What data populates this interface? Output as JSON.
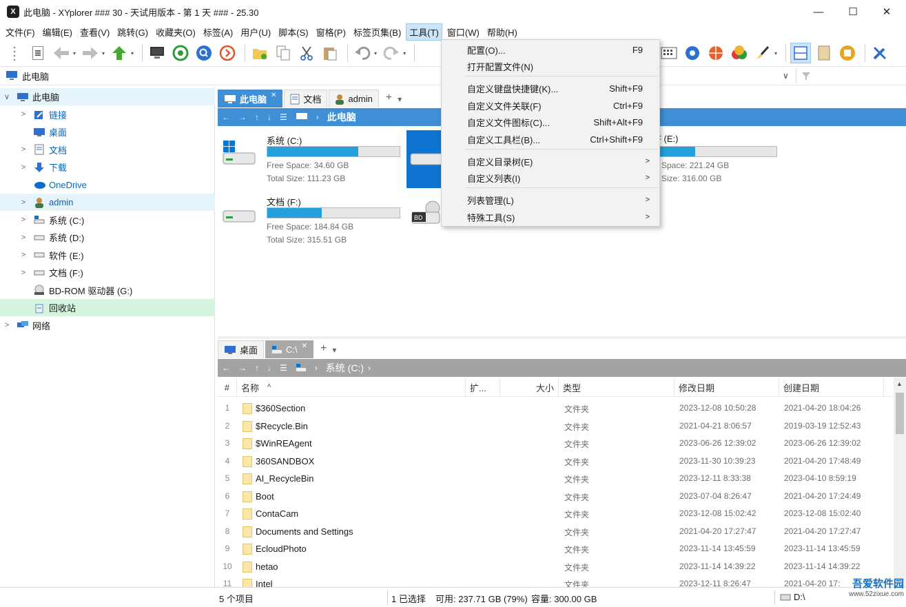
{
  "window": {
    "title": "此电脑 - XYplorer ### 30 - 天试用版本 - 第 1 天 ### - 25.30",
    "logo_text": "X",
    "minimize": "—",
    "maximize": "☐",
    "close": "✕"
  },
  "menubar": [
    "文件(F)",
    "编辑(E)",
    "查看(V)",
    "跳转(G)",
    "收藏夹(O)",
    "标签(A)",
    "用户(U)",
    "脚本(S)",
    "窗格(P)",
    "标签页集(B)",
    "工具(T)",
    "窗口(W)",
    "帮助(H)"
  ],
  "active_menu_index": 10,
  "address": {
    "text": "此电脑"
  },
  "tree": [
    {
      "label": "此电脑",
      "expand": "∨",
      "indent": 0,
      "icon": "computer-icon",
      "style": "sel-blue"
    },
    {
      "label": "链接",
      "expand": ">",
      "indent": 1,
      "icon": "link-icon",
      "style": "blue"
    },
    {
      "label": "桌面",
      "expand": "",
      "indent": 1,
      "icon": "desktop-icon",
      "style": "blue"
    },
    {
      "label": "文档",
      "expand": ">",
      "indent": 1,
      "icon": "document-icon",
      "style": "blue"
    },
    {
      "label": "下载",
      "expand": ">",
      "indent": 1,
      "icon": "download-icon",
      "style": "blue"
    },
    {
      "label": "OneDrive",
      "expand": "",
      "indent": 1,
      "icon": "onedrive-icon",
      "style": "blue"
    },
    {
      "label": "admin",
      "expand": ">",
      "indent": 1,
      "icon": "user-icon",
      "style": "blue-bg"
    },
    {
      "label": "系统 (C:)",
      "expand": ">",
      "indent": 1,
      "icon": "drive-c-icon",
      "style": ""
    },
    {
      "label": "系统 (D:)",
      "expand": ">",
      "indent": 1,
      "icon": "drive-icon",
      "style": ""
    },
    {
      "label": "软件 (E:)",
      "expand": ">",
      "indent": 1,
      "icon": "drive-icon",
      "style": ""
    },
    {
      "label": "文档 (F:)",
      "expand": ">",
      "indent": 1,
      "icon": "drive-icon",
      "style": ""
    },
    {
      "label": "BD-ROM 驱动器 (G:)",
      "expand": "",
      "indent": 1,
      "icon": "bdrom-icon",
      "style": ""
    },
    {
      "label": "回收站",
      "expand": "",
      "indent": 1,
      "icon": "recycle-bin-icon",
      "style": "sel-green"
    },
    {
      "label": "网络",
      "expand": ">",
      "indent": 0,
      "icon": "network-icon",
      "style": ""
    }
  ],
  "top_pane": {
    "tabs": [
      {
        "label": "此电脑",
        "close": "✕"
      },
      {
        "label": "文档"
      },
      {
        "label": "admin"
      }
    ],
    "add_tab": "+",
    "tab_menu": "▾",
    "breadcrumb": "此电脑",
    "drives": [
      {
        "name": "系统 (C:)",
        "used": 0.69,
        "free": "Free Space: 34.60 GB",
        "total": "Total Size: 111.23 GB"
      },
      {
        "name": "F (E:)",
        "used": 0.3,
        "free": "Space: 221.24 GB",
        "total": "Size: 316.00 GB"
      },
      {
        "name": "文档 (F:)",
        "used": 0.41,
        "free": "Free Space: 184.84 GB",
        "total": "Total Size: 315.51 GB"
      }
    ],
    "bd_label": "BD"
  },
  "tools_menu": {
    "items": [
      {
        "label": "配置(O)...",
        "shortcut": "F9"
      },
      {
        "label": "打开配置文件(N)",
        "shortcut": ""
      },
      {
        "label": "自定义键盘快捷键(K)...",
        "shortcut": "Shift+F9"
      },
      {
        "label": "自定义文件关联(F)",
        "shortcut": "Ctrl+F9"
      },
      {
        "label": "自定义文件图标(C)...",
        "shortcut": "Shift+Alt+F9"
      },
      {
        "label": "自定义工具栏(B)...",
        "shortcut": "Ctrl+Shift+F9"
      },
      {
        "label": "自定义目录树(E)",
        "shortcut": ""
      },
      {
        "label": "自定义列表(I)",
        "shortcut": ""
      },
      {
        "label": "列表管理(L)",
        "shortcut": ""
      },
      {
        "label": "特殊工具(S)",
        "shortcut": ""
      }
    ],
    "submenu_arrow": ">"
  },
  "bottom_pane": {
    "tabs": [
      {
        "label": "桌面"
      },
      {
        "label": "C:\\",
        "close": "✕"
      }
    ],
    "add_tab": "+",
    "tab_menu": "▾",
    "breadcrumb": "系统 (C:)",
    "columns": {
      "num": "#",
      "name": "名称",
      "sort": "^",
      "ext": "扩...",
      "size": "大小",
      "type": "类型",
      "modified": "修改日期",
      "created": "创建日期"
    },
    "rows": [
      {
        "n": "1",
        "name": "$360Section",
        "type": "文件夹",
        "modified": "2023-12-08 10:50:28",
        "created": "2021-04-20 18:04:26"
      },
      {
        "n": "2",
        "name": "$Recycle.Bin",
        "type": "文件夹",
        "modified": "2021-04-21 8:06:57",
        "created": "2019-03-19 12:52:43"
      },
      {
        "n": "3",
        "name": "$WinREAgent",
        "type": "文件夹",
        "modified": "2023-06-26 12:39:02",
        "created": "2023-06-26 12:39:02"
      },
      {
        "n": "4",
        "name": "360SANDBOX",
        "type": "文件夹",
        "modified": "2023-11-30 10:39:23",
        "created": "2021-04-20 17:48:49"
      },
      {
        "n": "5",
        "name": "AI_RecycleBin",
        "type": "文件夹",
        "modified": "2023-12-11 8:33:38",
        "created": "2023-04-10 8:59:19"
      },
      {
        "n": "6",
        "name": "Boot",
        "type": "文件夹",
        "modified": "2023-07-04 8:26:47",
        "created": "2021-04-20 17:24:49"
      },
      {
        "n": "7",
        "name": "ContaCam",
        "type": "文件夹",
        "modified": "2023-12-08 15:02:42",
        "created": "2023-12-08 15:02:40"
      },
      {
        "n": "8",
        "name": "Documents and Settings",
        "type": "文件夹",
        "modified": "2021-04-20 17:27:47",
        "created": "2021-04-20 17:27:47"
      },
      {
        "n": "9",
        "name": "EcloudPhoto",
        "type": "文件夹",
        "modified": "2023-11-14 13:45:59",
        "created": "2023-11-14 13:45:59"
      },
      {
        "n": "10",
        "name": "hetao",
        "type": "文件夹",
        "modified": "2023-11-14 14:39:22",
        "created": "2023-11-14 14:39:22"
      },
      {
        "n": "11",
        "name": "Intel",
        "type": "文件夹",
        "modified": "2023-12-11 8:26:47",
        "created": "2021-04-20 17:"
      }
    ]
  },
  "status": {
    "items": "5 个项目",
    "selection": "1 已选择",
    "free": "可用: 237.71 GB (79%)",
    "capacity": "容量: 300.00 GB",
    "drive": "D:\\"
  },
  "watermark": {
    "main": "吾爱软件园",
    "sub": "www.52zixue.com"
  },
  "colors": {
    "accent": "#3f8fd6",
    "drive_bar": "#26a0da",
    "tree_sel": "#e5f3fb",
    "recycle_sel": "#d6f5df",
    "menu_active": "#cce4f7"
  }
}
